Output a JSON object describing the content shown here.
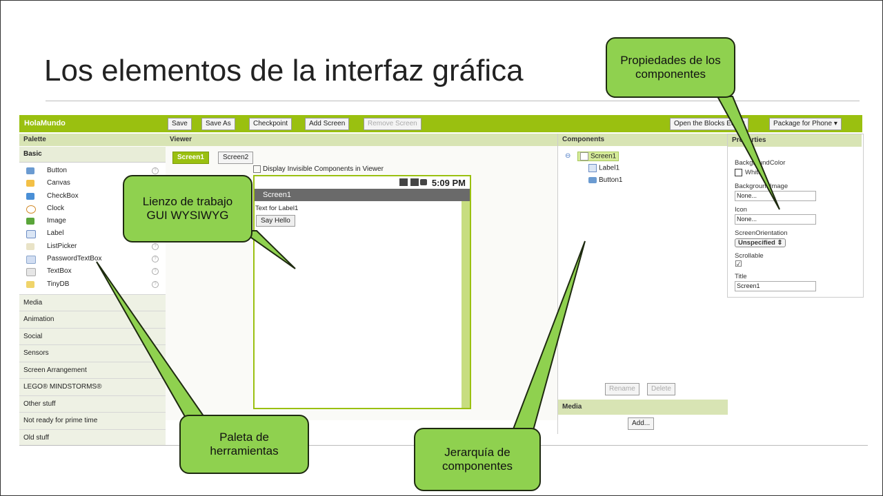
{
  "slide": {
    "title": "Los elementos de la interfaz gráfica"
  },
  "app": {
    "name": "HolaMundo",
    "toolbar": {
      "save": "Save",
      "save_as": "Save As",
      "checkpoint": "Checkpoint",
      "add_screen": "Add Screen",
      "remove_screen": "Remove Screen",
      "open_blocks": "Open the Blocks Editor",
      "package": "Package for Phone ▾"
    },
    "palette": {
      "header": "Palette",
      "basic": "Basic",
      "items": [
        "Button",
        "Canvas",
        "CheckBox",
        "Clock",
        "Image",
        "Label",
        "ListPicker",
        "PasswordTextBox",
        "TextBox",
        "TinyDB"
      ],
      "categories": [
        "Media",
        "Animation",
        "Social",
        "Sensors",
        "Screen Arrangement",
        "LEGO® MINDSTORMS®",
        "Other stuff",
        "Not ready for prime time",
        "Old stuff"
      ]
    },
    "viewer": {
      "header": "Viewer",
      "tab1": "Screen1",
      "tab2": "Screen2",
      "display_invisible": "Display Invisible Components in Viewer",
      "time": "5:09 PM",
      "screen_title": "Screen1",
      "label_text": "Text for Label1",
      "button_text": "Say Hello"
    },
    "components": {
      "header": "Components",
      "screen": "Screen1",
      "label": "Label1",
      "button": "Button1",
      "rename": "Rename",
      "delete": "Delete",
      "media_header": "Media",
      "add": "Add..."
    },
    "properties": {
      "header": "Properties",
      "bg_color_label": "BackgroundColor",
      "bg_color_value": "White",
      "bg_image_label": "BackgroundImage",
      "bg_image_value": "None...",
      "icon_label": "Icon",
      "icon_value": "None...",
      "orientation_label": "ScreenOrientation",
      "orientation_value": "Unspecified ⇕",
      "scrollable_label": "Scrollable",
      "title_label": "Title",
      "title_value": "Screen1"
    }
  },
  "callouts": {
    "properties": "Propiedades de los componentes",
    "canvas": "Lienzo de trabajo GUI WYSIWYG",
    "palette": "Paleta de herramientas",
    "hierarchy": "Jerarquía de componentes"
  },
  "colors": {
    "accent": "#9ac010",
    "callout": "#8fd14f"
  }
}
